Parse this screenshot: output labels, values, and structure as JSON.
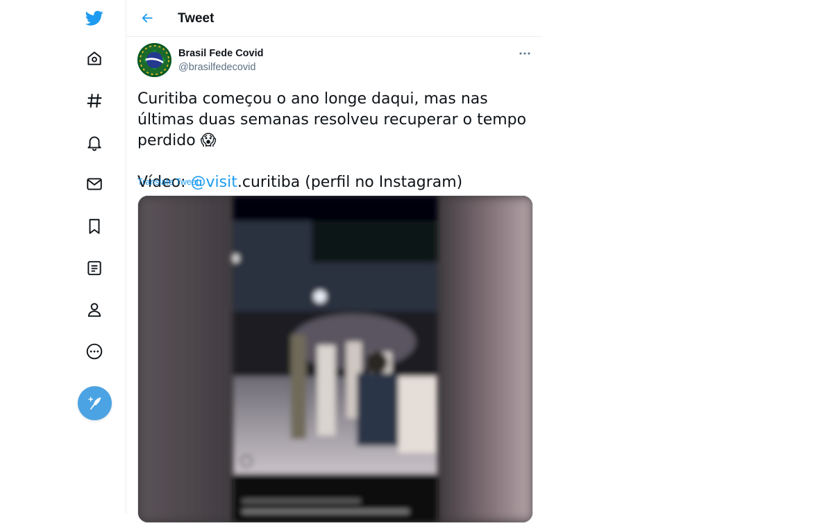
{
  "header": {
    "title": "Tweet"
  },
  "sidebar": {
    "items": [
      {
        "icon": "twitter-logo-icon"
      },
      {
        "icon": "home-icon"
      },
      {
        "icon": "explore-hashtag-icon"
      },
      {
        "icon": "notifications-bell-icon"
      },
      {
        "icon": "messages-mail-icon"
      },
      {
        "icon": "bookmarks-icon"
      },
      {
        "icon": "lists-icon"
      },
      {
        "icon": "profile-icon"
      },
      {
        "icon": "more-icon"
      },
      {
        "icon": "compose-tweet-icon"
      }
    ],
    "accent_color": "#1d9bf0"
  },
  "tweet": {
    "author_name": "Brasil Fede Covid",
    "author_handle": "@brasilfedecovid",
    "text_line1": "Curitiba começou o ano longe daqui, mas nas últimas duas semanas resolveu recuperar o tempo perdido",
    "emoji": "😱",
    "video_prefix": "Vídeo: ",
    "mention": "@visit",
    "video_suffix": ".curitiba (perfil no Instagram)",
    "translate_label": "Translate Tweet",
    "media_caption": "visit.curitiba Pré-inauguração da churrascaria NATIVAS"
  }
}
